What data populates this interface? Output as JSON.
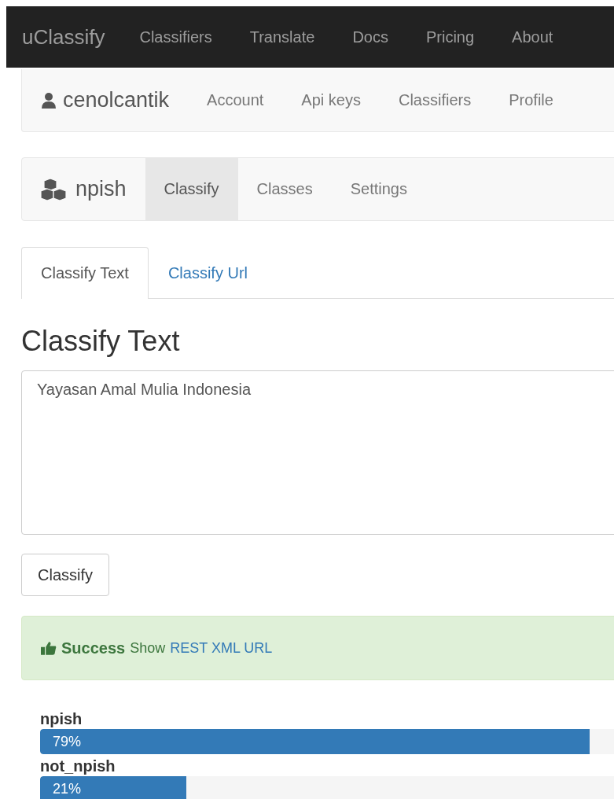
{
  "navbar": {
    "brand": "uClassify",
    "items": [
      {
        "label": "Classifiers"
      },
      {
        "label": "Translate"
      },
      {
        "label": "Docs"
      },
      {
        "label": "Pricing"
      },
      {
        "label": "About"
      }
    ]
  },
  "user_nav": {
    "username": "cenolcantik",
    "items": [
      {
        "label": "Account"
      },
      {
        "label": "Api keys"
      },
      {
        "label": "Classifiers"
      },
      {
        "label": "Profile"
      }
    ]
  },
  "classifier_nav": {
    "name": "npish",
    "items": [
      {
        "label": "Classify",
        "selected": true
      },
      {
        "label": "Classes",
        "selected": false
      },
      {
        "label": "Settings",
        "selected": false
      }
    ]
  },
  "tabs": [
    {
      "label": "Classify Text",
      "selected": true
    },
    {
      "label": "Classify Url",
      "selected": false
    }
  ],
  "heading": "Classify Text",
  "text_input": {
    "value": "Yayasan Amal Mulia Indonesia"
  },
  "classify_button": "Classify",
  "alert": {
    "title": "Success",
    "prefix": "Show",
    "link": "REST XML URL"
  },
  "results": [
    {
      "name": "npish",
      "level": 0.79,
      "reading": "79%"
    },
    {
      "name": "not_npish",
      "level": 0.21,
      "reading": "21%"
    }
  ]
}
